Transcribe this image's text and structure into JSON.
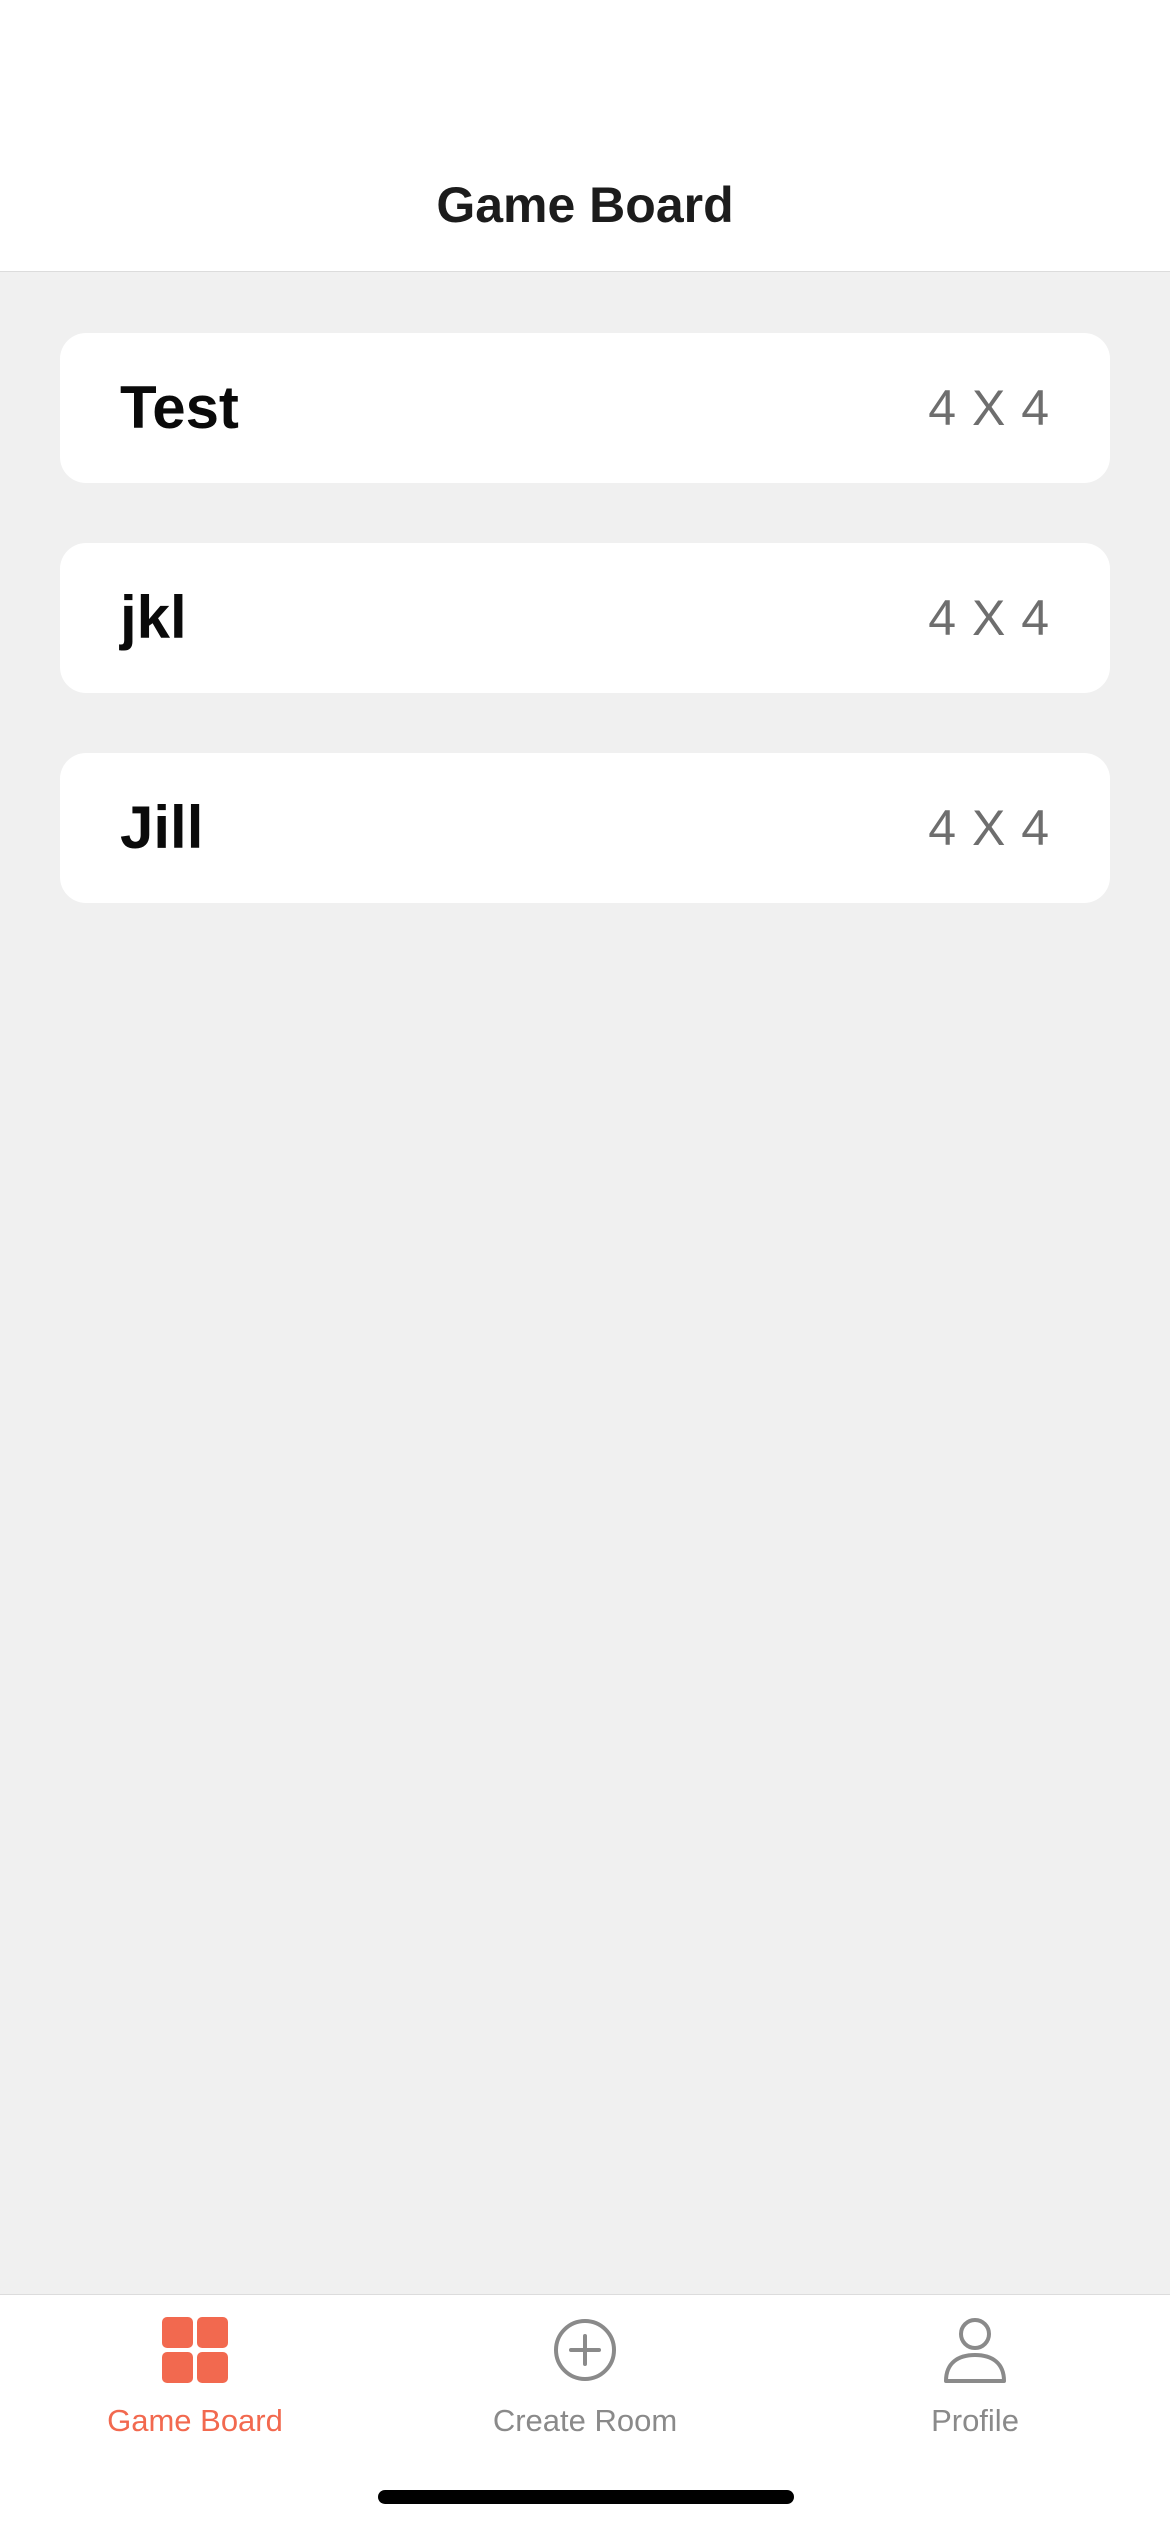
{
  "header": {
    "title": "Game Board"
  },
  "rooms": [
    {
      "name": "Test",
      "size": "4 X 4"
    },
    {
      "name": "jkl",
      "size": "4 X 4"
    },
    {
      "name": "Jill",
      "size": "4 X 4"
    }
  ],
  "tabbar": {
    "items": [
      {
        "label": "Game Board",
        "icon": "grid-icon",
        "active": true
      },
      {
        "label": "Create Room",
        "icon": "plus-circle-icon",
        "active": false
      },
      {
        "label": "Profile",
        "icon": "person-icon",
        "active": false
      }
    ]
  },
  "colors": {
    "accent": "#f2694f",
    "inactive": "#8a8a8a",
    "background": "#f0f0f0"
  }
}
